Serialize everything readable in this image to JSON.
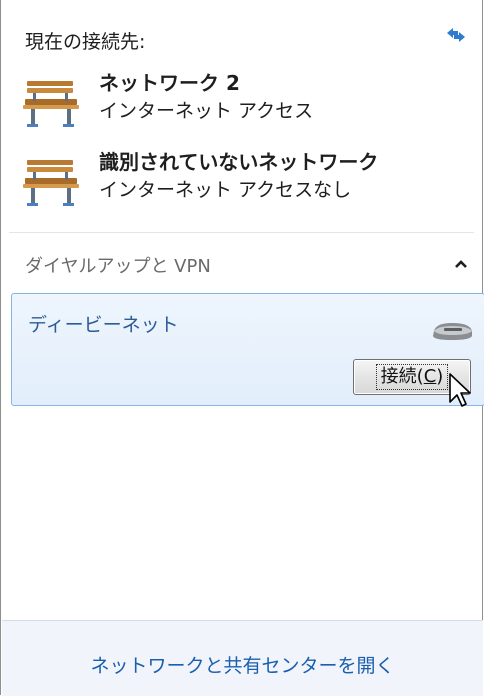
{
  "header": {
    "label": "現在の接続先:",
    "refresh_icon": "refresh-icon"
  },
  "networks": [
    {
      "name": "ネットワーク 2",
      "status": "インターネット アクセス",
      "icon": "bench-network-icon"
    },
    {
      "name": "識別されていないネットワーク",
      "status": "インターネット アクセスなし",
      "icon": "bench-network-icon"
    }
  ],
  "dialup_section": {
    "title": "ダイヤルアップと VPN",
    "expanded": true,
    "items": [
      {
        "name": "ディービーネット",
        "icon": "modem-icon",
        "button_label": "接続(C)",
        "button_shortcut": "C"
      }
    ]
  },
  "footer": {
    "link": "ネットワークと共有センターを開く"
  },
  "colors": {
    "selection_border": "#86b4e5",
    "selection_bg": "#e2eefb",
    "link": "#1a5fae",
    "footer_bg": "#f1f5fb"
  }
}
